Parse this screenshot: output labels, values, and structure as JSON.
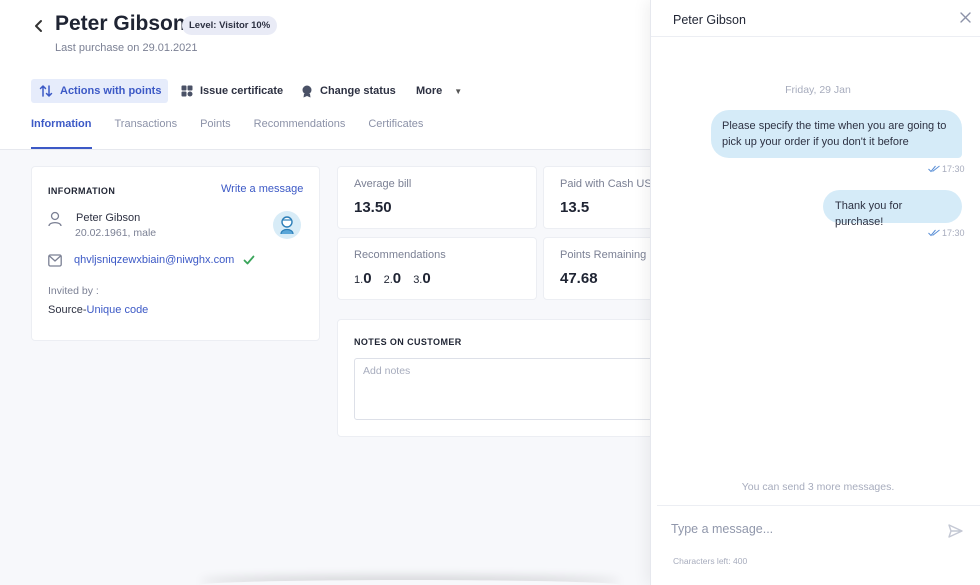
{
  "customer": {
    "back_icon": "chevron-left-icon",
    "name": "Peter Gibson",
    "level_badge": "Level: Visitor 10%",
    "last_purchase": "Last purchase on 29.01.2021"
  },
  "actions": {
    "points_label": "Actions with points",
    "certificate_label": "Issue certificate",
    "status_label": "Change status",
    "more_label": "More",
    "caret": "▼"
  },
  "tabs": [
    {
      "label": "Information",
      "active": true
    },
    {
      "label": "Transactions",
      "active": false
    },
    {
      "label": "Points",
      "active": false
    },
    {
      "label": "Recommendations",
      "active": false
    },
    {
      "label": "Certificates",
      "active": false
    }
  ],
  "info": {
    "title": "INFORMATION",
    "write_message": "Write a message",
    "person_name": "Peter Gibson",
    "person_meta": "20.02.1961, male",
    "email": "qhvljsniqzewxbiain@niwghx.com",
    "invited_by": "Invited by :",
    "source_prefix": "Source-",
    "source_link": "Unique code"
  },
  "stats": {
    "average_bill_label": "Average bill",
    "average_bill_value": "13.50",
    "paid_cash_label": "Paid with Cash US",
    "paid_cash_value": "13.5",
    "recommendations_label": "Recommendations",
    "rec1_prefix": "1.",
    "rec1_value": "0",
    "rec2_prefix": "2.",
    "rec2_value": "0",
    "rec3_prefix": "3.",
    "rec3_value": "0",
    "points_label": "Points Remaining",
    "points_value": "47.68"
  },
  "notes": {
    "title": "NOTES ON CUSTOMER",
    "placeholder": "Add notes"
  },
  "chat": {
    "title": "Peter Gibson",
    "date_separator": "Friday, 29 Jan",
    "messages": [
      {
        "text": "Please specify the time when you are going to pick up your order if you don't it before",
        "time": "17:30"
      },
      {
        "text": "Thank you for purchase!",
        "time": "17:30"
      }
    ],
    "limit_note": "You can send 3 more messages.",
    "input_placeholder": "Type a message...",
    "chars_left": "Characters left: 400"
  },
  "colors": {
    "accent": "#3c59c6",
    "bubble": "#d5ebf8",
    "verified": "#3aa55b"
  }
}
